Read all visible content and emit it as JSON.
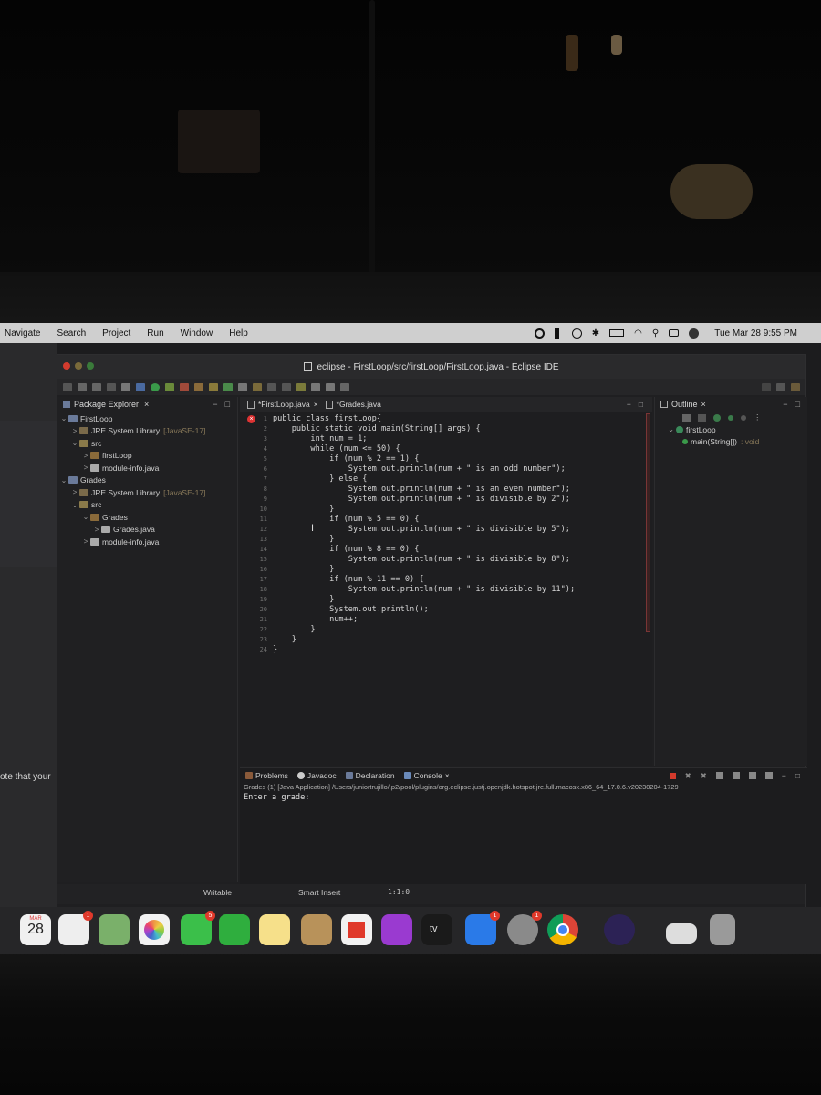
{
  "menubar": {
    "items": [
      "Navigate",
      "Search",
      "Project",
      "Run",
      "Window",
      "Help"
    ],
    "clock": "Tue Mar 28  9:55 PM"
  },
  "window": {
    "title": "eclipse - FirstLoop/src/firstLoop/FirstLoop.java - Eclipse IDE"
  },
  "package_explorer": {
    "tab_label": "Package Explorer",
    "tree": [
      {
        "label": "FirstLoop",
        "detail": "",
        "level": 0,
        "toggle": "⌄",
        "icon": "project"
      },
      {
        "label": "JRE System Library",
        "detail": "[JavaSE-17]",
        "level": 1,
        "toggle": ">",
        "icon": "library"
      },
      {
        "label": "src",
        "detail": "",
        "level": 1,
        "toggle": "⌄",
        "icon": "folder"
      },
      {
        "label": "firstLoop",
        "detail": "",
        "level": 2,
        "toggle": ">",
        "icon": "package"
      },
      {
        "label": "module-info.java",
        "detail": "",
        "level": 2,
        "toggle": ">",
        "icon": "file"
      },
      {
        "label": "Grades",
        "detail": "",
        "level": 0,
        "toggle": "⌄",
        "icon": "project"
      },
      {
        "label": "JRE System Library",
        "detail": "[JavaSE-17]",
        "level": 1,
        "toggle": ">",
        "icon": "library"
      },
      {
        "label": "src",
        "detail": "",
        "level": 1,
        "toggle": "⌄",
        "icon": "folder"
      },
      {
        "label": "Grades",
        "detail": "",
        "level": 2,
        "toggle": "⌄",
        "icon": "package"
      },
      {
        "label": "Grades.java",
        "detail": "",
        "level": 3,
        "toggle": ">",
        "icon": "file"
      },
      {
        "label": "module-info.java",
        "detail": "",
        "level": 2,
        "toggle": ">",
        "icon": "file"
      }
    ]
  },
  "editor": {
    "tabs": [
      {
        "label": "*FirstLoop.java",
        "closable": "×"
      },
      {
        "label": "*Grades.java",
        "closable": ""
      }
    ],
    "lines": [
      "public class firstLoop{",
      "    public static void main(String[] args) {",
      "        int num = 1;",
      "        while (num <= 50) {",
      "            if (num % 2 == 1) {",
      "                System.out.println(num + \" is an odd number\");",
      "            } else {",
      "                System.out.println(num + \" is an even number\");",
      "                System.out.println(num + \" is divisible by 2\");",
      "            }",
      "            if (num % 5 == 0) {",
      "                System.out.println(num + \" is divisible by 5\");",
      "            }",
      "            if (num % 8 == 0) {",
      "                System.out.println(num + \" is divisible by 8\");",
      "            }",
      "            if (num % 11 == 0) {",
      "                System.out.println(num + \" is divisible by 11\");",
      "            }",
      "            System.out.println();",
      "            num++;",
      "        }",
      "    }",
      "}"
    ]
  },
  "outline": {
    "tab_label": "Outline",
    "items": [
      {
        "label": "firstLoop",
        "detail": ""
      },
      {
        "label": "main(String[])",
        "detail": ": void"
      }
    ]
  },
  "console": {
    "tabs": [
      "Problems",
      "Javadoc",
      "Declaration",
      "Console"
    ],
    "description": "Grades (1) [Java Application] /Users/juniortrujillo/.p2/pool/plugins/org.eclipse.justj.openjdk.hotspot.jre.full.macosx.x86_64_17.0.6.v20230204-1729",
    "output": "Enter a grade:"
  },
  "status": {
    "writable": "Writable",
    "insert_mode": "Smart Insert",
    "position": "1:1:0"
  },
  "desktop": {
    "partial_text": "ote that your"
  },
  "dock": {
    "calendar_month": "MAR",
    "calendar_day": "28",
    "tv_label": "tv",
    "badges": [
      "1",
      "5",
      "1",
      "1"
    ]
  },
  "colors": {
    "accent_red": "#d33a2c",
    "keyword": "#cc7832",
    "code_text": "#d6d6d6"
  }
}
